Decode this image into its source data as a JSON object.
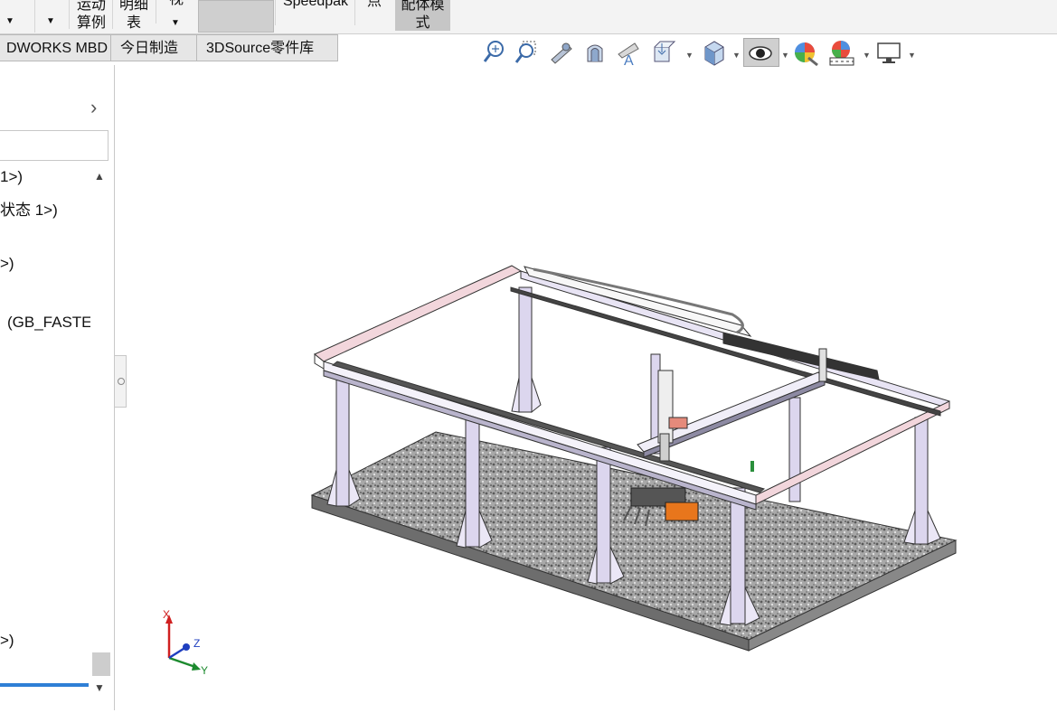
{
  "ribbon": {
    "items": [
      {
        "line1": "运动",
        "line2": "算例"
      },
      {
        "line1": "明细",
        "line2": "表"
      },
      {
        "line1": "视",
        "line2": ""
      },
      {
        "line1": "",
        "line2": ""
      },
      {
        "line1": "Speedpak",
        "line2": ""
      },
      {
        "line1": "点",
        "line2": ""
      },
      {
        "line1": "配体模",
        "line2": "式"
      }
    ]
  },
  "tabs": [
    "DWORKS MBD",
    "今日制造",
    "3DSource零件库"
  ],
  "view_toolbar": {
    "icons": [
      "zoom-to-fit-icon",
      "zoom-to-area-icon",
      "previous-view-icon",
      "section-view-icon",
      "dynamic-annotation-icon",
      "view-orientation-icon",
      "display-style-icon",
      "hide-show-items-icon",
      "edit-appearance-icon",
      "apply-scene-icon",
      "view-settings-icon"
    ]
  },
  "tree": {
    "items": [
      "1>)",
      "状态 1>)",
      ">)",
      "(GB_FASTE",
      ">)"
    ]
  },
  "triad": {
    "x": "X",
    "y": "Y",
    "z": "Z"
  },
  "colors": {
    "accent": "#2f7fd6",
    "frame": "#dcd6ee",
    "rail_pink": "#f2d6dc",
    "granite": "#9a9a9a",
    "gripper": "#e8761c"
  }
}
